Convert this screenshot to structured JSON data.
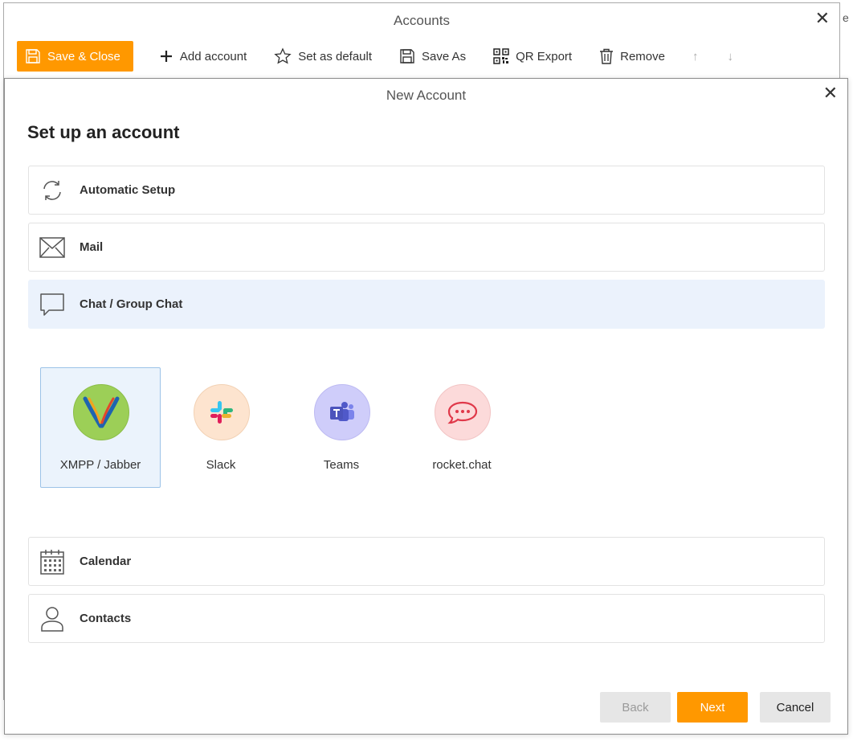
{
  "accounts_window": {
    "title": "Accounts",
    "close": "✕",
    "edge_letter": "e",
    "toolbar": {
      "save_close": "Save & Close",
      "add_account": "Add account",
      "set_default": "Set as default",
      "save_as": "Save As",
      "qr_export": "QR Export",
      "remove": "Remove",
      "move_up": "↑",
      "move_down": "↓"
    }
  },
  "dialog": {
    "title": "New Account",
    "close": "✕",
    "heading": "Set up an account",
    "options": [
      {
        "label": "Automatic Setup",
        "icon": "sync-icon"
      },
      {
        "label": "Mail",
        "icon": "envelope-icon"
      },
      {
        "label": "Chat / Group Chat",
        "icon": "chat-bubble-icon",
        "selected": true
      },
      {
        "label": "Calendar",
        "icon": "calendar-icon"
      },
      {
        "label": "Contacts",
        "icon": "person-icon"
      }
    ],
    "chat_providers": [
      {
        "label": "XMPP / Jabber",
        "icon": "xmpp-icon",
        "selected": true
      },
      {
        "label": "Slack",
        "icon": "slack-icon"
      },
      {
        "label": "Teams",
        "icon": "teams-icon"
      },
      {
        "label": "rocket.chat",
        "icon": "rocket-chat-icon"
      }
    ],
    "buttons": {
      "back": "Back",
      "next": "Next",
      "cancel": "Cancel"
    }
  },
  "colors": {
    "accent": "#ff9800",
    "selected_bg": "#ebf2fc",
    "selected_border": "#9cc3e8"
  }
}
